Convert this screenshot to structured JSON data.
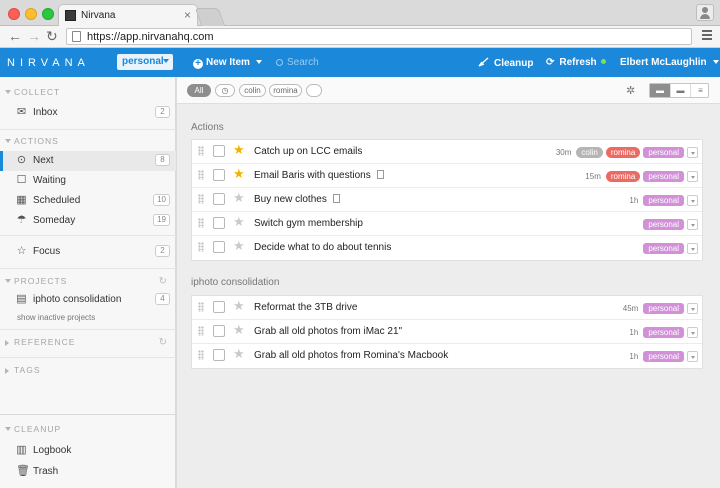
{
  "browser": {
    "tab_title": "Nirvana",
    "tab_close": "×",
    "url_scheme": "https://",
    "url_host": "app.nirvanahq.com",
    "back_glyph": "←",
    "forward_glyph": "→",
    "reload_glyph": "↻"
  },
  "header": {
    "logo": "NIRVANA",
    "context": "personal",
    "new_item": "New Item",
    "search_placeholder": "Search",
    "cleanup": "Cleanup",
    "refresh": "Refresh",
    "user": "Elbert McLaughlin",
    "accent_color": "#1b88d9"
  },
  "sidebar": {
    "collect": {
      "header": "COLLECT",
      "items": [
        {
          "label": "Inbox",
          "count": "2",
          "icon": "inbox-icon"
        }
      ]
    },
    "actions": {
      "header": "ACTIONS",
      "items": [
        {
          "label": "Next",
          "count": "8",
          "icon": "next-icon",
          "active": true
        },
        {
          "label": "Waiting",
          "icon": "waiting-icon"
        },
        {
          "label": "Scheduled",
          "count": "10",
          "icon": "calendar-icon"
        },
        {
          "label": "Someday",
          "count": "19",
          "icon": "umbrella-icon"
        }
      ]
    },
    "focus": {
      "label": "Focus",
      "count": "2",
      "icon": "star-icon"
    },
    "projects": {
      "header": "PROJECTS",
      "items": [
        {
          "label": "iphoto consolidation",
          "count": "4",
          "icon": "project-icon"
        }
      ],
      "show_inactive": "show inactive projects"
    },
    "reference": {
      "header": "REFERENCE"
    },
    "tags": {
      "header": "TAGS"
    },
    "cleanup": {
      "header": "CLEANUP",
      "items": [
        {
          "label": "Logbook",
          "icon": "logbook-icon"
        },
        {
          "label": "Trash",
          "icon": "trash-icon"
        }
      ]
    }
  },
  "toolbar": {
    "filter_all": "All",
    "filter_colin": "colin",
    "filter_romina": "romina"
  },
  "groups": [
    {
      "title": "Actions",
      "tasks": [
        {
          "title": "Catch up on LCC emails",
          "starred": true,
          "note": false,
          "time": "30m",
          "tags": [
            "colin",
            "romina",
            "personal"
          ]
        },
        {
          "title": "Email Baris with questions",
          "starred": true,
          "note": true,
          "time": "15m",
          "tags": [
            "romina",
            "personal"
          ]
        },
        {
          "title": "Buy new clothes",
          "starred": false,
          "note": true,
          "time": "1h",
          "tags": [
            "personal"
          ]
        },
        {
          "title": "Switch gym membership",
          "starred": false,
          "note": false,
          "time": "",
          "tags": [
            "personal"
          ]
        },
        {
          "title": "Decide what to do about tennis",
          "starred": false,
          "note": false,
          "time": "",
          "tags": [
            "personal"
          ]
        }
      ]
    },
    {
      "title": "iphoto consolidation",
      "tasks": [
        {
          "title": "Reformat the 3TB drive",
          "starred": false,
          "note": false,
          "time": "45m",
          "tags": [
            "personal"
          ]
        },
        {
          "title": "Grab all old photos from iMac 21\"",
          "starred": false,
          "note": false,
          "time": "1h",
          "tags": [
            "personal"
          ]
        },
        {
          "title": "Grab all old photos from Romina's Macbook",
          "starred": false,
          "note": false,
          "time": "1h",
          "tags": [
            "personal"
          ]
        }
      ]
    }
  ],
  "tag_colors": {
    "colin": "#b5b5b5",
    "romina": "#ea6a64",
    "personal": "#d190d8"
  }
}
